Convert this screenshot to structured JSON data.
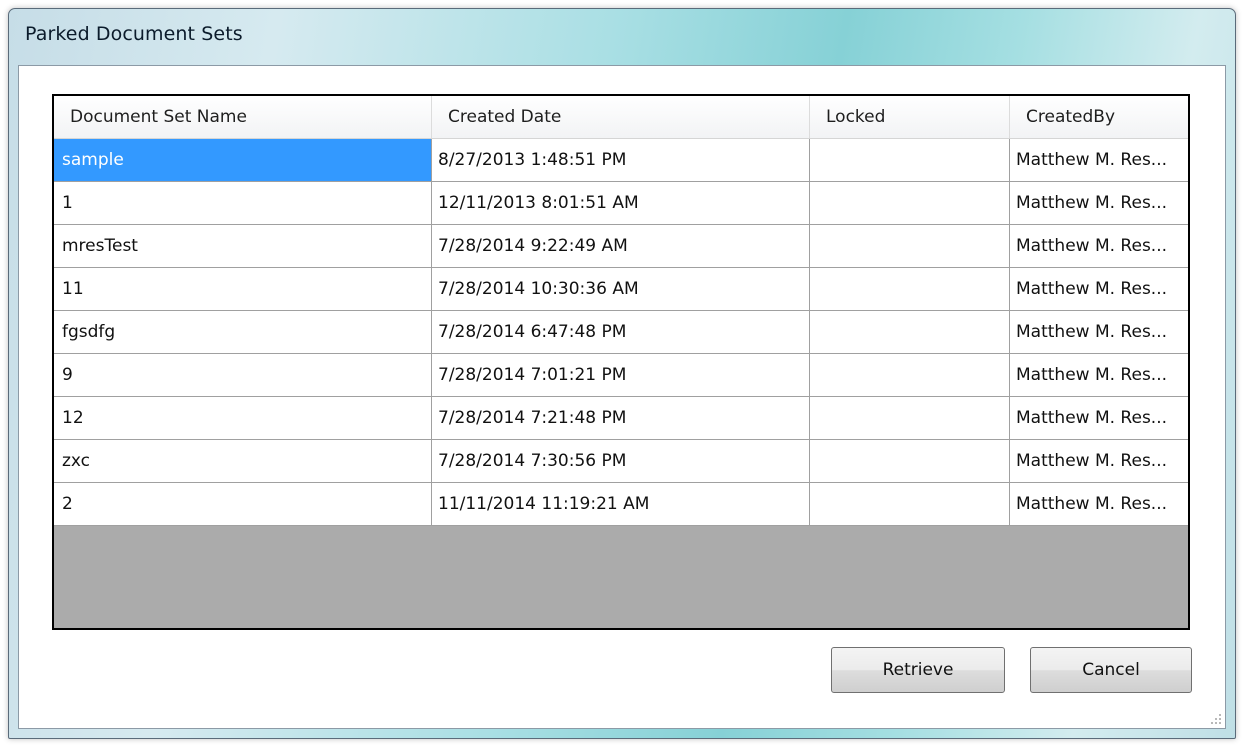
{
  "window": {
    "title": "Parked Document Sets"
  },
  "grid": {
    "columns": [
      "Document Set Name",
      "Created Date",
      "Locked",
      "CreatedBy"
    ],
    "selected_row": 0,
    "rows": [
      {
        "name": "sample",
        "created": "8/27/2013 1:48:51 PM",
        "locked": "",
        "createdBy": "Matthew M. Res..."
      },
      {
        "name": "1",
        "created": "12/11/2013 8:01:51 AM",
        "locked": "",
        "createdBy": "Matthew M. Res..."
      },
      {
        "name": "mresTest",
        "created": "7/28/2014 9:22:49 AM",
        "locked": "",
        "createdBy": "Matthew M. Res..."
      },
      {
        "name": "11",
        "created": "7/28/2014 10:30:36 AM",
        "locked": "",
        "createdBy": "Matthew M. Res..."
      },
      {
        "name": "fgsdfg",
        "created": "7/28/2014 6:47:48 PM",
        "locked": "",
        "createdBy": "Matthew M. Res..."
      },
      {
        "name": "9",
        "created": "7/28/2014 7:01:21 PM",
        "locked": "",
        "createdBy": "Matthew M. Res..."
      },
      {
        "name": "12",
        "created": "7/28/2014 7:21:48 PM",
        "locked": "",
        "createdBy": "Matthew M. Res..."
      },
      {
        "name": "zxc",
        "created": "7/28/2014 7:30:56 PM",
        "locked": "",
        "createdBy": "Matthew M. Res..."
      },
      {
        "name": "2",
        "created": "11/11/2014 11:19:21 AM",
        "locked": "",
        "createdBy": "Matthew M. Res..."
      }
    ]
  },
  "buttons": {
    "retrieve": "Retrieve",
    "cancel": "Cancel"
  },
  "colors": {
    "selection": "#3399ff",
    "empty_area": "#ababab"
  }
}
